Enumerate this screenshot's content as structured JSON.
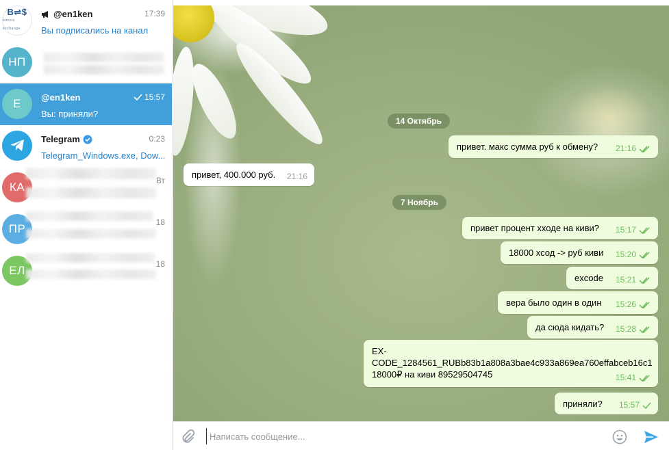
{
  "dialogs": [
    {
      "avatar_text": "B⇌$",
      "avatar_sub": "bitcoin exchange",
      "name": "@en1ken",
      "time": "17:39",
      "preview": "Вы подписались на канал",
      "avatar_color": "#ffffff"
    },
    {
      "avatar_text": "НП",
      "avatar_color": "#56b3cc"
    },
    {
      "avatar_text": "E",
      "name": "@en1ken",
      "time": "15:57",
      "preview": "Вы: приняли?",
      "avatar_color": "#6ec9cb"
    },
    {
      "name": "Telegram",
      "time": "0:23",
      "preview": "Telegram_Windows.exe, Dow...",
      "avatar_color": "#2ca5e0"
    },
    {
      "avatar_text": "КА",
      "time": "Вт",
      "avatar_color": "#e16a6a"
    },
    {
      "avatar_text": "ПР",
      "time": "18",
      "avatar_color": "#5caee2"
    },
    {
      "avatar_text": "ЕЛ",
      "time": "18",
      "avatar_color": "#7bc862"
    }
  ],
  "chat": {
    "dates": [
      "14 Октябрь",
      "7 Ноябрь"
    ],
    "messages": [
      {
        "text": "привет. макс сумма руб к обмену?",
        "time": "21:16",
        "dir": "out"
      },
      {
        "text": "привет, 400.000 руб.",
        "time": "21:16",
        "dir": "in"
      },
      {
        "text": "привет процент хходе на киви?",
        "time": "15:17",
        "dir": "out"
      },
      {
        "text": "18000 хсод -> руб киви",
        "time": "15:20",
        "dir": "out"
      },
      {
        "text": "excode",
        "time": "15:21",
        "dir": "out"
      },
      {
        "text": "вера было один в один",
        "time": "15:26",
        "dir": "out"
      },
      {
        "text": "да сюда кидать?",
        "time": "15:28",
        "dir": "out"
      },
      {
        "line1": "EX-",
        "line2": "CODE_1284561_RUBb83b1a808a3bae4c933a869ea760effabceb16c1",
        "line3": "18000₽ на киви 89529504745",
        "time": "15:41",
        "dir": "out"
      },
      {
        "text": "приняли?",
        "time": "15:57",
        "dir": "out"
      }
    ]
  },
  "input": {
    "placeholder": "Написать сообщение..."
  },
  "colors": {
    "accent": "#419fd9",
    "outgoing": "#effdde",
    "tick": "#6cba5b",
    "date_pill": "#758c60"
  },
  "icons": {
    "channel": "megaphone-icon",
    "verified": "verified-badge-icon",
    "read": "double-check-icon",
    "sent": "check-icon",
    "attach": "paperclip-icon",
    "emoji": "emoji-icon",
    "send": "send-icon"
  }
}
